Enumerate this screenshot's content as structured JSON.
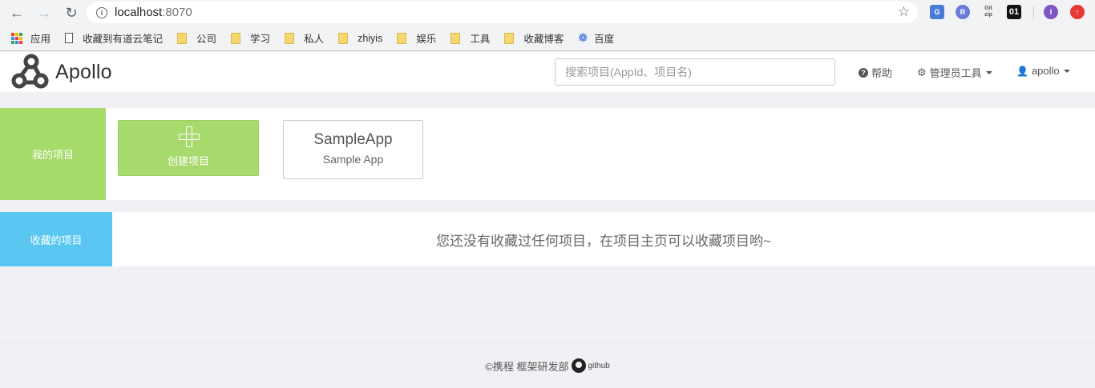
{
  "browser": {
    "url_host": "localhost",
    "url_port": ":8070",
    "bookmarks": [
      {
        "label": "应用",
        "type": "apps"
      },
      {
        "label": "收藏到有道云笔记",
        "type": "doc"
      },
      {
        "label": "公司",
        "type": "folder"
      },
      {
        "label": "学习",
        "type": "folder"
      },
      {
        "label": "私人",
        "type": "folder"
      },
      {
        "label": "zhiyis",
        "type": "folder"
      },
      {
        "label": "娱乐",
        "type": "folder"
      },
      {
        "label": "工具",
        "type": "folder"
      },
      {
        "label": "收藏博客",
        "type": "folder"
      },
      {
        "label": "百度",
        "type": "baidu"
      }
    ],
    "extensions": [
      {
        "label": "G",
        "color": "#4a7bd8"
      },
      {
        "label": "R",
        "color": "#6b7bdc"
      },
      {
        "label": "Git zip",
        "color": "#ffffff"
      },
      {
        "label": "01",
        "color": "#111111"
      },
      {
        "label": "I",
        "color": "#7e57c2"
      },
      {
        "label": "↑",
        "color": "#e53935"
      }
    ]
  },
  "header": {
    "logo_text": "Apollo",
    "search_placeholder": "搜索项目(AppId、项目名)",
    "help_label": "帮助",
    "admin_tools_label": "管理员工具",
    "user_label": "apollo"
  },
  "my_projects": {
    "section_label": "我的项目",
    "create_label": "创建项目",
    "apps": [
      {
        "app_id": "SampleApp",
        "name": "Sample App"
      }
    ]
  },
  "favorites": {
    "section_label": "收藏的项目",
    "empty_message": "您还没有收藏过任何项目，在项目主页可以收藏项目哟~"
  },
  "footer": {
    "copyright": "©携程 框架研发部",
    "github_label": "github"
  },
  "colors": {
    "my_projects_accent": "#a6db6a",
    "favorites_accent": "#59c7f2",
    "create_card": "#a7d96c"
  }
}
